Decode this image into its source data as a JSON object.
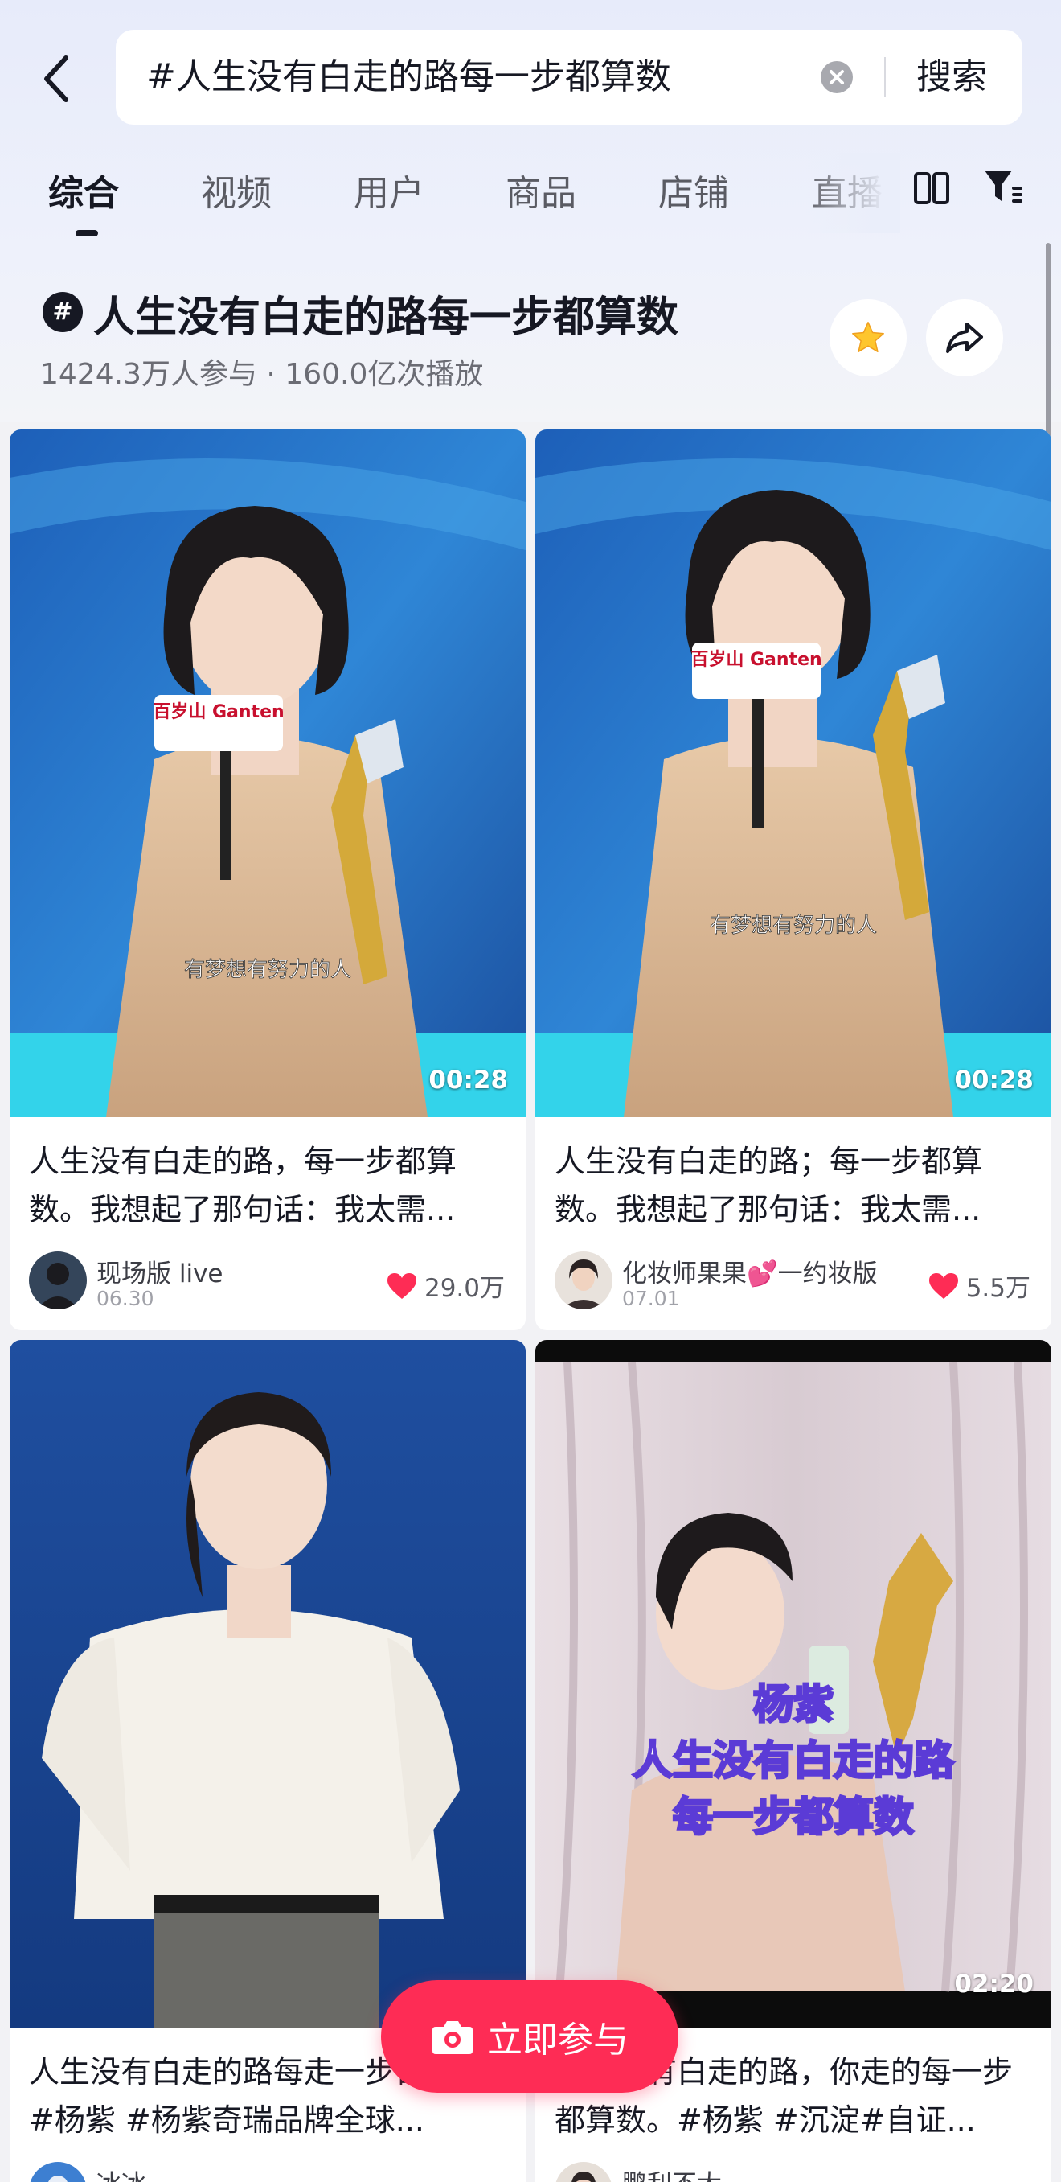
{
  "search": {
    "query": "#人生没有白走的路每一步都算数",
    "submit_label": "搜索"
  },
  "tabs": [
    {
      "label": "综合",
      "active": true
    },
    {
      "label": "视频"
    },
    {
      "label": "用户"
    },
    {
      "label": "商品"
    },
    {
      "label": "店铺"
    },
    {
      "label": "直播"
    }
  ],
  "topic": {
    "badge": "#",
    "title": "人生没有白走的路每一步都算数",
    "stats": "1424.3万人参与 · 160.0亿次播放"
  },
  "cards": [
    {
      "title": "人生没有白走的路，每一步都算数。我想起了那句话：我太需...",
      "duration": "00:28",
      "author": "现场版 live",
      "date": "06.30",
      "likes": "29.0万",
      "subtitle": "有梦想有努力的人",
      "mic_logo": "百岁山 Ganten"
    },
    {
      "title": "人生没有白走的路；每一步都算数。我想起了那句话：我太需...",
      "duration": "00:28",
      "author": "化妆师果果💕一约妆版",
      "date": "07.01",
      "likes": "5.5万",
      "subtitle": "有梦想有努力的人",
      "mic_logo": "百岁山 Ganten"
    },
    {
      "title": "人生没有白走的路每走一步都算数#杨紫 #杨紫奇瑞品牌全球...",
      "author": "冰冰"
    },
    {
      "title": "人生没有白走的路，你走的每一步都算数。#杨紫 #沉淀#自证...",
      "duration": "02:20",
      "author": "鹏利不大",
      "overlay_lines": [
        "杨紫",
        "人生没有白走的路",
        "每一步都算数"
      ]
    }
  ],
  "join_button": {
    "label": "立即参与"
  },
  "colors": {
    "accent": "#fe2c55",
    "star": "#fec62e",
    "background": "#f2f2f5"
  }
}
